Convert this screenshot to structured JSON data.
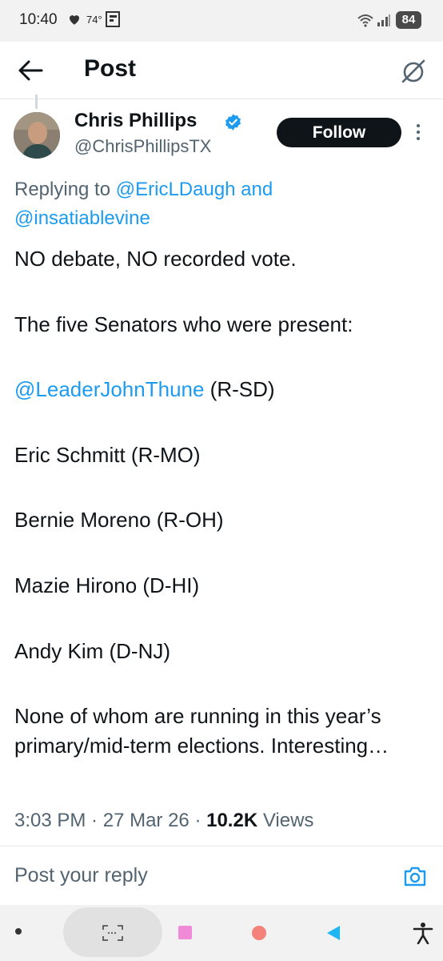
{
  "status_bar": {
    "time": "10:40",
    "temperature": "74°",
    "battery": "84",
    "icons": [
      "heart-icon",
      "flipboard-icon",
      "wifi-icon",
      "signal-icon",
      "battery-icon"
    ]
  },
  "header": {
    "title": "Post",
    "back_icon": "arrow-left-icon",
    "grok_icon": "grok-icon"
  },
  "author": {
    "display_name": "Chris Phillips",
    "handle": "@ChrisPhillipsTX",
    "verified": true,
    "follow_label": "Follow"
  },
  "replying": {
    "prefix": "Replying to ",
    "user1": "@EricLDaugh",
    "and": " and",
    "user2": "@insatiablevine"
  },
  "post": {
    "line1": "NO debate, NO recorded vote.",
    "line2": "The five Senators who were present:",
    "mention": "@LeaderJohnThune",
    "mention_suffix": " (R-SD)",
    "senator2": "Eric Schmitt (R-MO)",
    "senator3": "Bernie Moreno (R-OH)",
    "senator4": "Mazie Hirono (D-HI)",
    "senator5": "Andy Kim (D-NJ)",
    "closing": "None of whom are running in this year’s primary/mid-term elections. Interesting…"
  },
  "meta": {
    "time": "3:03 PM",
    "sep1": " · ",
    "date": "27 Mar 26",
    "sep2": " · ",
    "views_count": "10.2K",
    "views_label": " Views"
  },
  "reply_bar": {
    "placeholder": "Post your reply",
    "camera_icon": "camera-icon"
  },
  "colors": {
    "link": "#1d9bf0",
    "text": "#0f1419",
    "muted": "#536471",
    "follow_bg": "#0f1419"
  }
}
